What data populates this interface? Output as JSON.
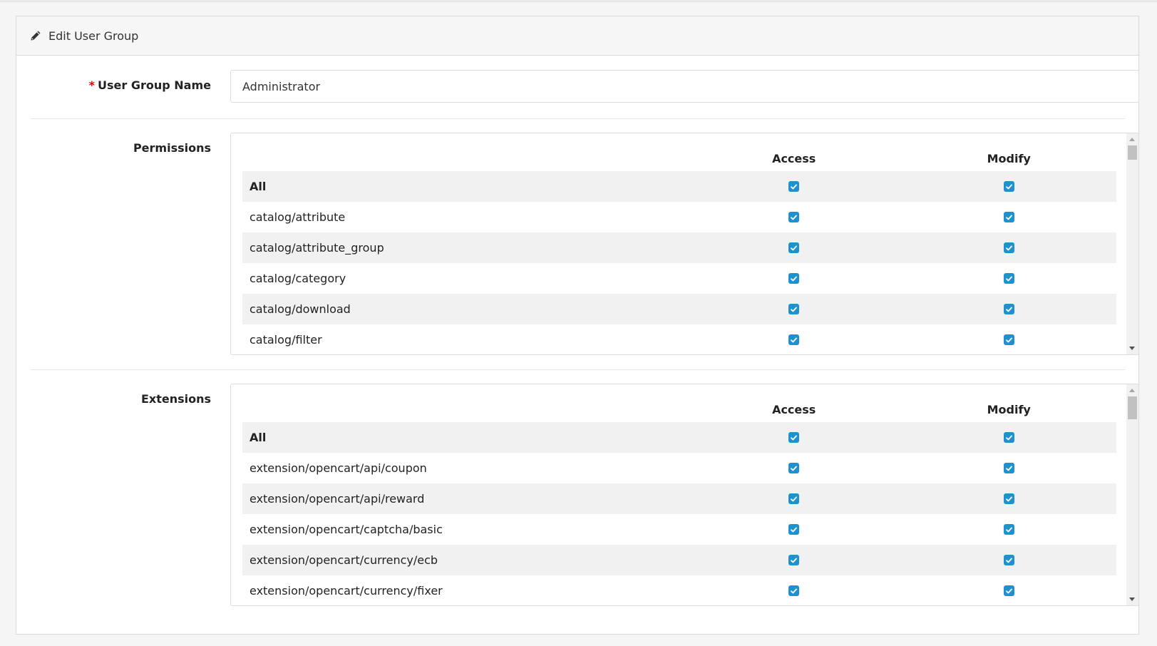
{
  "panel": {
    "title": "Edit User Group",
    "icon": "pencil-icon"
  },
  "form": {
    "name_label": "User Group Name",
    "required_mark": "*",
    "name_value": "Administrator",
    "permissions_label": "Permissions",
    "extensions_label": "Extensions"
  },
  "permissions": {
    "headers": {
      "name": "",
      "access": "Access",
      "modify": "Modify"
    },
    "rows": [
      {
        "name": "All",
        "bold": true,
        "access": true,
        "modify": true
      },
      {
        "name": "catalog/attribute",
        "access": true,
        "modify": true
      },
      {
        "name": "catalog/attribute_group",
        "access": true,
        "modify": true
      },
      {
        "name": "catalog/category",
        "access": true,
        "modify": true
      },
      {
        "name": "catalog/download",
        "access": true,
        "modify": true
      },
      {
        "name": "catalog/filter",
        "access": true,
        "modify": true
      }
    ]
  },
  "extensions": {
    "headers": {
      "name": "",
      "access": "Access",
      "modify": "Modify"
    },
    "rows": [
      {
        "name": "All",
        "bold": true,
        "access": true,
        "modify": true
      },
      {
        "name": "extension/opencart/api/coupon",
        "access": true,
        "modify": true
      },
      {
        "name": "extension/opencart/api/reward",
        "access": true,
        "modify": true
      },
      {
        "name": "extension/opencart/captcha/basic",
        "access": true,
        "modify": true
      },
      {
        "name": "extension/opencart/currency/ecb",
        "access": true,
        "modify": true
      },
      {
        "name": "extension/opencart/currency/fixer",
        "access": true,
        "modify": true
      }
    ]
  },
  "colors": {
    "checkbox": "#1e91cf",
    "required": "#ee0000"
  }
}
